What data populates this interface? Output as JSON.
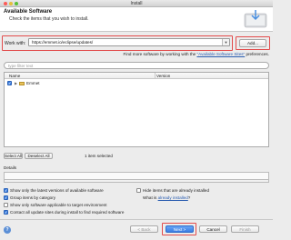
{
  "window": {
    "title": "Install"
  },
  "header": {
    "title": "Available Software",
    "subtitle": "Check the items that you wish to install."
  },
  "work_with": {
    "label": "Work with:",
    "value": "https://emmet.io/eclipse/updates/",
    "add_label": "Add..."
  },
  "find_more": {
    "prefix": "Find more software by working with the ",
    "link": "\"Available Software Sites\"",
    "suffix": " preferences."
  },
  "filter": {
    "placeholder": "type filter text"
  },
  "tree": {
    "columns": [
      "Name",
      "Version"
    ],
    "items": [
      {
        "name": "Emmet",
        "checked": true,
        "expanded": false
      }
    ]
  },
  "selection": {
    "select_all": "Select All",
    "deselect_all": "Deselect All",
    "count_text": "1 item selected"
  },
  "details": {
    "label": "Details"
  },
  "options": {
    "latest_versions": {
      "label": "Show only the latest versions of available software",
      "checked": true
    },
    "group_by_category": {
      "label": "Group items by category",
      "checked": true
    },
    "target_env": {
      "label": "Show only software applicable to target environment",
      "checked": false
    },
    "contact_sites": {
      "label": "Contact all update sites during install to find required software",
      "checked": true
    },
    "hide_installed": {
      "label": "Hide items that are already installed",
      "checked": false
    },
    "already_installed_prefix": "What is ",
    "already_installed_link": "already installed",
    "already_installed_suffix": "?"
  },
  "footer": {
    "help": "?",
    "back": "< Back",
    "next": "Next >",
    "cancel": "Cancel",
    "finish": "Finish"
  },
  "colors": {
    "highlight": "#e24b4b",
    "accent": "#3a7de3",
    "link": "#2a5db0"
  }
}
